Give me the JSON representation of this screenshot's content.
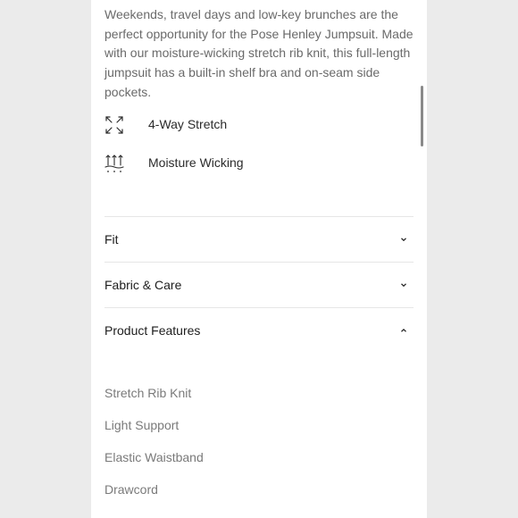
{
  "description": "Weekends, travel days and low-key brunches are the perfect opportunity for the Pose Henley Jumpsuit. Made with our moisture-wicking stretch rib knit, this full-length jumpsuit has a built-in shelf bra and on-seam side pockets.",
  "features": [
    {
      "icon": "four-way-arrows-icon",
      "label": "4-Way Stretch"
    },
    {
      "icon": "moisture-wicking-icon",
      "label": "Moisture Wicking"
    }
  ],
  "accordion": [
    {
      "title": "Fit",
      "state": "collapsed"
    },
    {
      "title": "Fabric & Care",
      "state": "collapsed"
    },
    {
      "title": "Product Features",
      "state": "expanded"
    }
  ],
  "product_features": [
    "Stretch Rib Knit",
    "Light Support",
    "Elastic Waistband",
    "Drawcord"
  ],
  "colors": {
    "panel": "#ffffff",
    "page": "#ebebeb",
    "text": "#1d1d1d",
    "muted": "#7a7a7a"
  }
}
